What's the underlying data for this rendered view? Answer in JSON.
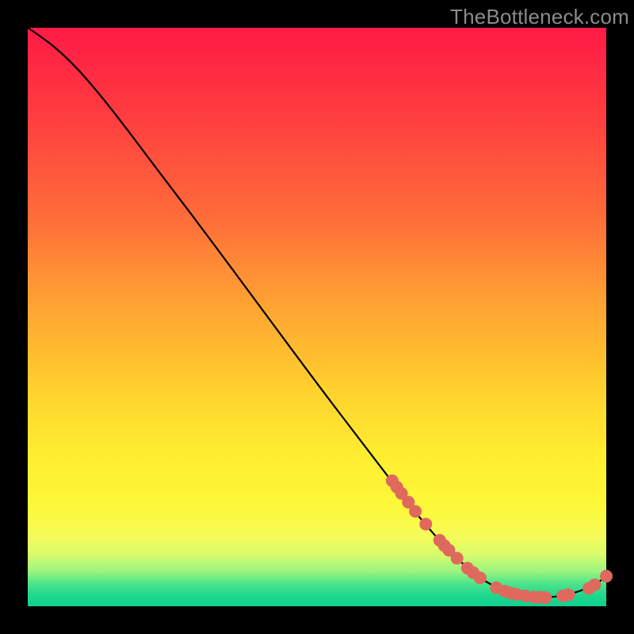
{
  "watermark": "TheBottleneck.com",
  "colors": {
    "dot": "#e0695e",
    "curve": "#000000"
  },
  "chart_data": {
    "type": "line",
    "title": "",
    "xlabel": "",
    "ylabel": "",
    "xlim": [
      0,
      100
    ],
    "ylim": [
      0,
      100
    ],
    "grid": false,
    "legend": false,
    "curve": [
      {
        "x": 0,
        "y": 100
      },
      {
        "x": 3,
        "y": 98
      },
      {
        "x": 6,
        "y": 95.5
      },
      {
        "x": 9,
        "y": 92.5
      },
      {
        "x": 12,
        "y": 89
      },
      {
        "x": 16,
        "y": 84
      },
      {
        "x": 22,
        "y": 76
      },
      {
        "x": 30,
        "y": 65.5
      },
      {
        "x": 40,
        "y": 52
      },
      {
        "x": 50,
        "y": 38.5
      },
      {
        "x": 58,
        "y": 28
      },
      {
        "x": 63,
        "y": 21.5
      },
      {
        "x": 66,
        "y": 17.5
      },
      {
        "x": 69,
        "y": 13.8
      },
      {
        "x": 72,
        "y": 10.5
      },
      {
        "x": 75,
        "y": 7.5
      },
      {
        "x": 78,
        "y": 5
      },
      {
        "x": 81,
        "y": 3.2
      },
      {
        "x": 84,
        "y": 2.1
      },
      {
        "x": 87,
        "y": 1.6
      },
      {
        "x": 90,
        "y": 1.5
      },
      {
        "x": 93,
        "y": 1.9
      },
      {
        "x": 96,
        "y": 2.8
      },
      {
        "x": 98.5,
        "y": 4
      },
      {
        "x": 100,
        "y": 5.2
      }
    ],
    "points": [
      {
        "x": 63,
        "y": 21.7
      },
      {
        "x": 63.8,
        "y": 20.6
      },
      {
        "x": 64.6,
        "y": 19.5
      },
      {
        "x": 65.8,
        "y": 18
      },
      {
        "x": 67,
        "y": 16.4
      },
      {
        "x": 68.8,
        "y": 14.2
      },
      {
        "x": 71.2,
        "y": 11.4
      },
      {
        "x": 72,
        "y": 10.5
      },
      {
        "x": 72.8,
        "y": 9.7
      },
      {
        "x": 74.2,
        "y": 8.3
      },
      {
        "x": 76,
        "y": 6.6
      },
      {
        "x": 77,
        "y": 5.8
      },
      {
        "x": 78.2,
        "y": 4.9
      },
      {
        "x": 81,
        "y": 3.2
      },
      {
        "x": 82.5,
        "y": 2.6
      },
      {
        "x": 83.5,
        "y": 2.3
      },
      {
        "x": 84.5,
        "y": 2.05
      },
      {
        "x": 86,
        "y": 1.8
      },
      {
        "x": 87.5,
        "y": 1.6
      },
      {
        "x": 88.5,
        "y": 1.55
      },
      {
        "x": 89.5,
        "y": 1.5
      },
      {
        "x": 92.5,
        "y": 1.8
      },
      {
        "x": 93.5,
        "y": 2.0
      },
      {
        "x": 97,
        "y": 3.1
      },
      {
        "x": 98,
        "y": 3.7
      },
      {
        "x": 100,
        "y": 5.2
      }
    ]
  }
}
